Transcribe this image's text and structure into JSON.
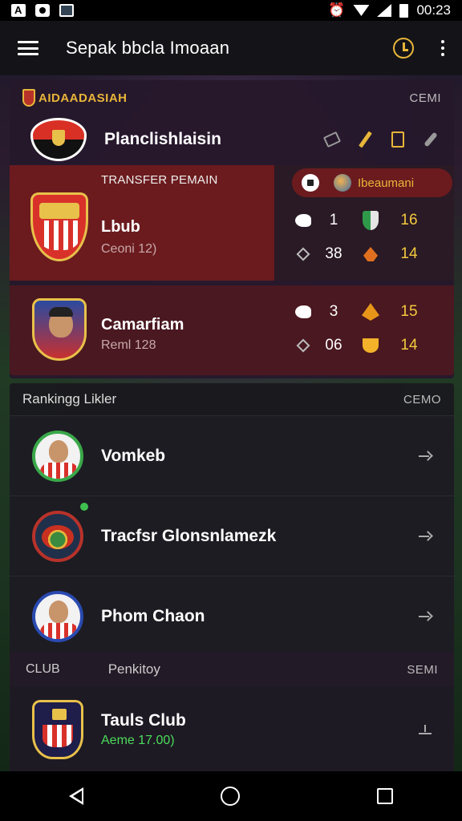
{
  "status_bar": {
    "time": "00:23"
  },
  "app_bar": {
    "title": "Sepak bbcla Imoaan"
  },
  "section_top": {
    "brand": "AIDAADASIAH",
    "more": "CEMI",
    "featured": {
      "name": "Planclishlaisin"
    },
    "transfer": {
      "title": "TRANSFER PEMAIN",
      "player": {
        "name": "Lbub",
        "sub": "Ceoni 12)"
      },
      "pill_label": "Ibeaumani",
      "stats": [
        {
          "value_a": "1",
          "value_b": "16"
        },
        {
          "value_a": "38",
          "value_b": "14"
        }
      ]
    },
    "second": {
      "name": "Camarfiam",
      "sub": "Reml 128",
      "stats": [
        {
          "value_a": "3",
          "value_b": "15"
        },
        {
          "value_a": "06",
          "value_b": "14"
        }
      ]
    }
  },
  "ranking": {
    "title": "Rankingg Likler",
    "more": "CEMO",
    "items": [
      {
        "name": "Vomkeb"
      },
      {
        "name": "Tracfsr Glonsnlamezk"
      },
      {
        "name": "Phom Chaon"
      }
    ]
  },
  "club": {
    "label": "CLUB",
    "rank_label": "Penkitoy",
    "more": "SEMI",
    "item": {
      "name": "Tauls Club",
      "sub": "Aeme 17.00)"
    }
  },
  "colors": {
    "accent": "#e8b63a",
    "transfer_bg": "#6b1b1e",
    "positive": "#4bdc5a"
  }
}
